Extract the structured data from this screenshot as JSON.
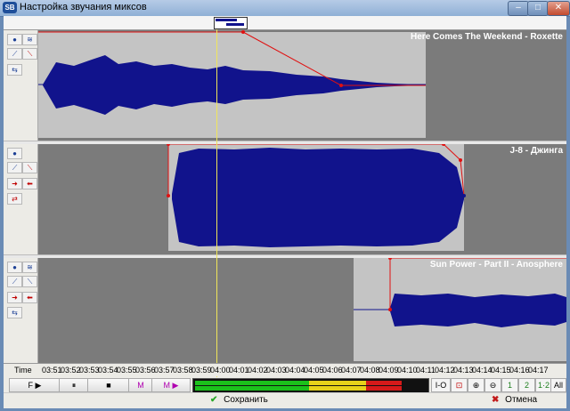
{
  "window": {
    "title": "Настройка звучания миксов",
    "icon_text": "SB"
  },
  "tracks": [
    {
      "title": "Here Comes The Weekend - Roxette"
    },
    {
      "title": "J-8 - Джинга"
    },
    {
      "title": "Sun Power - Part II - Anosphere"
    }
  ],
  "ruler": {
    "label": "Time",
    "ticks": [
      "03:51",
      "03:52",
      "03:53",
      "03:54",
      "03:55",
      "03:56",
      "03:57",
      "03:58",
      "03:59",
      "04:00",
      "04:01",
      "04:02",
      "04:03",
      "04:04",
      "04:05",
      "04:06",
      "04:07",
      "04:08",
      "04:09",
      "04:10",
      "04:11",
      "04:12",
      "04:13",
      "04:14",
      "04:15",
      "04:16",
      "04:17"
    ]
  },
  "transport": {
    "play_label": "F ▶",
    "pause_label": "⏸",
    "stop_label": "■",
    "mark_label": "M",
    "mark_play_label": "M ▶",
    "io_label": "I-O",
    "all_label": "All"
  },
  "meter_colors": {
    "green": "#1bc11b",
    "yellow": "#e6d21a",
    "red": "#d51a1a"
  },
  "actions": {
    "save_label": "Сохранить",
    "cancel_label": "Отмена"
  }
}
